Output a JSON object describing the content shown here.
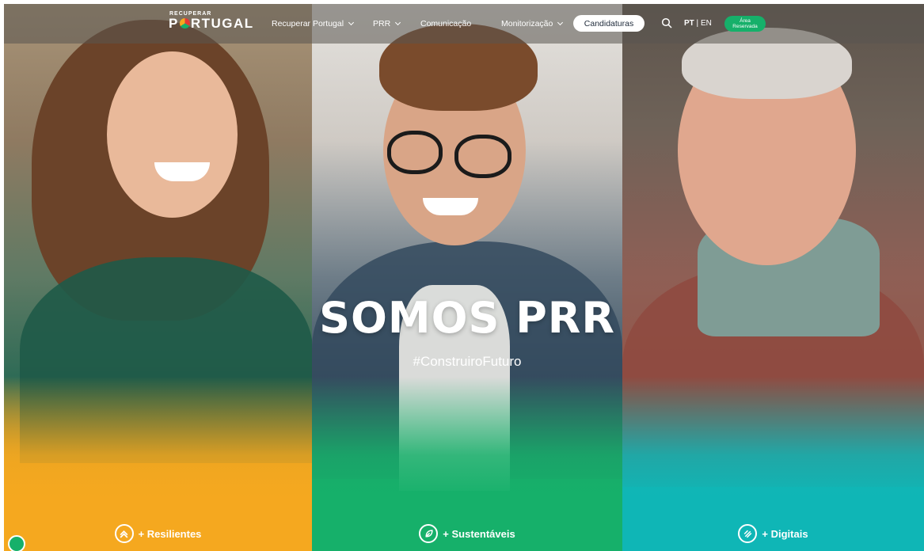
{
  "header": {
    "logo_small": "RECUPERAR",
    "logo_big_pre": "P",
    "logo_big_post": "RTUGAL",
    "nav": [
      {
        "label": "Recuperar Portugal",
        "has_dropdown": true
      },
      {
        "label": "PRR",
        "has_dropdown": true
      },
      {
        "label": "Comunicação",
        "has_dropdown": false
      },
      {
        "label": "Monitorização",
        "has_dropdown": true
      }
    ],
    "cta_label": "Candidaturas",
    "search_icon": "search-icon",
    "lang_active": "PT",
    "lang_sep": " | ",
    "lang_other": "EN",
    "area_line1": "Área",
    "area_line2": "Reservada"
  },
  "hero": {
    "title": "SOMOS PRR",
    "hashtag": "#ConstruiroFuturo"
  },
  "panels": [
    {
      "label": "+ Resilientes",
      "icon": "chevrons-up-icon",
      "color": "#f5a81f"
    },
    {
      "label": "+ Sustentáveis",
      "icon": "leaf-icon",
      "color": "#16b06a"
    },
    {
      "label": "+ Digitais",
      "icon": "cursor-icon",
      "color": "#0fb6b6"
    }
  ],
  "colors": {
    "accent_green": "#16b06a",
    "accent_orange": "#f5a81f",
    "accent_teal": "#0fb6b6"
  }
}
